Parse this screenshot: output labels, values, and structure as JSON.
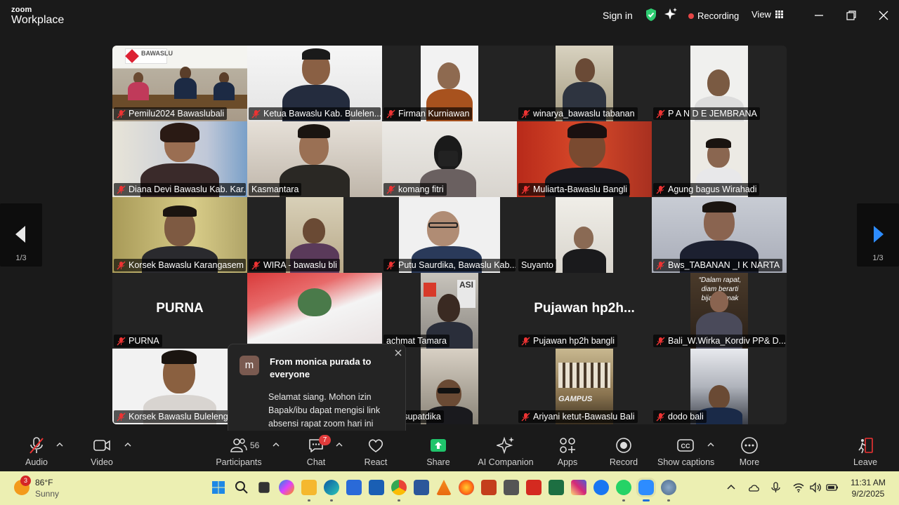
{
  "app": {
    "logo_line1": "zoom",
    "logo_line2": "Workplace",
    "sign_in": "Sign in",
    "recording": "Recording",
    "view": "View"
  },
  "pagination": {
    "left": "1/3",
    "right": "1/3"
  },
  "tiles": [
    {
      "name": "Pemilu2024 Bawaslubali"
    },
    {
      "name": "Ketua Bawaslu Kab. Bulelen..."
    },
    {
      "name": "Firman Kurniawan"
    },
    {
      "name": "winarya_bawaslu tabanan"
    },
    {
      "name": "P A N D E   JEMBRANA"
    },
    {
      "name": "Diana Devi Bawaslu Kab. Kar..."
    },
    {
      "name": "Kasmantara"
    },
    {
      "name": "komang fitri"
    },
    {
      "name": "Muliarta-Bawaslu Bangli"
    },
    {
      "name": "Agung bagus Wirahadi"
    },
    {
      "name": "Korsek Bawaslu Karangasem"
    },
    {
      "name": "WIRA - bawaslu bli"
    },
    {
      "name": "Putu Saurdika, Bawaslu Kab...."
    },
    {
      "name": "Suyanto"
    },
    {
      "name": "Bws_TABANAN _I K NARTA"
    },
    {
      "name": "PURNA",
      "big": "PURNA"
    },
    {
      "name": ""
    },
    {
      "name": "achmat Tamara"
    },
    {
      "name": "Pujawan  hp2h bangli",
      "big": "Pujawan   hp2h..."
    },
    {
      "name": "Bali_W.Wirka_Kordiv PP& D..."
    },
    {
      "name": "Korsek Bawaslu Buleleng"
    },
    {
      "name": ""
    },
    {
      "name": "ang supatdika"
    },
    {
      "name": "Ariyani ketut-Bawaslu Bali"
    },
    {
      "name": "dodo bali"
    }
  ],
  "chat_popup": {
    "avatar_letter": "m",
    "from": "From monica purada to everyone",
    "message": "Selamat siang. Mohon izin Bapak/ibu dapat mengisi link absensi rapat zoom hari ini melalui link d..."
  },
  "toolbar": {
    "audio": "Audio",
    "video": "Video",
    "participants": "Participants",
    "participants_count": "56",
    "chat": "Chat",
    "chat_badge": "7",
    "react": "React",
    "share": "Share",
    "ai_companion": "AI Companion",
    "apps": "Apps",
    "record": "Record",
    "show_captions": "Show captions",
    "more": "More",
    "leave": "Leave"
  },
  "taskbar": {
    "weather_badge": "3",
    "temperature": "86°F",
    "condition": "Sunny",
    "time": "11:31 AM",
    "date": "9/2/2025"
  },
  "colors": {
    "speaking_outline": "#3ad68a",
    "share_green": "#1fc46b",
    "recording_red": "#e54545",
    "taskbar_bg": "#ecefb2"
  }
}
